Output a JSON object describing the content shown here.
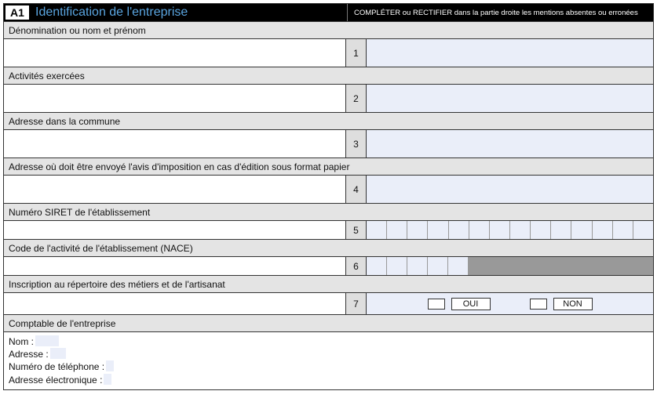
{
  "header": {
    "code": "A1",
    "title": "Identification de l'entreprise",
    "instruction": "COMPLÉTER ou RECTIFIER dans la partie droite les mentions absentes ou erronées"
  },
  "rows": {
    "r1": {
      "label": "Dénomination ou nom et prénom",
      "num": "1"
    },
    "r2": {
      "label": "Activités exercées",
      "num": "2"
    },
    "r3": {
      "label": "Adresse dans la commune",
      "num": "3"
    },
    "r4": {
      "label": "Adresse où doit être envoyé l'avis d'imposition en cas d'édition sous format papier",
      "num": "4"
    },
    "r5": {
      "label": "Numéro SIRET de l'établissement",
      "num": "5"
    },
    "r6": {
      "label": "Code de l'activité de l'établissement (NACE)",
      "num": "6"
    },
    "r7": {
      "label": "Inscription au répertoire des métiers et de l'artisanat",
      "num": "7",
      "yes": "OUI",
      "no": "NON"
    },
    "r8": {
      "label": "Comptable de l'entreprise"
    }
  },
  "comptable": {
    "name_lbl": "Nom :",
    "addr_lbl": "Adresse :",
    "phone_lbl": "Numéro de téléphone :",
    "email_lbl": "Adresse électronique :",
    "name": "",
    "addr": "",
    "phone": "",
    "email": ""
  }
}
